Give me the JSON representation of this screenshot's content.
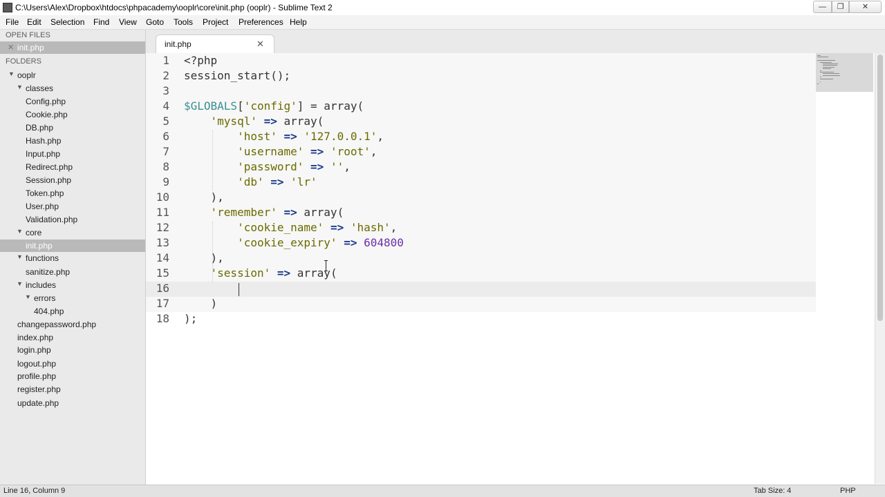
{
  "window": {
    "title": "C:\\Users\\Alex\\Dropbox\\htdocs\\phpacademy\\ooplr\\core\\init.php (ooplr) - Sublime Text 2",
    "min_glyph": "—",
    "max_glyph": "❐",
    "close_glyph": "✕"
  },
  "menu": [
    "File",
    "Edit",
    "Selection",
    "Find",
    "View",
    "Goto",
    "Tools",
    "Project",
    "Preferences",
    "Help"
  ],
  "sidebar": {
    "open_files_header": "OPEN FILES",
    "open_file": "init.php",
    "open_file_close": "✕",
    "folders_header": "FOLDERS",
    "tree": [
      {
        "label": "ooplr",
        "type": "folder"
      },
      {
        "label": "classes",
        "type": "folder"
      },
      {
        "label": "Config.php",
        "type": "file"
      },
      {
        "label": "Cookie.php",
        "type": "file"
      },
      {
        "label": "DB.php",
        "type": "file"
      },
      {
        "label": "Hash.php",
        "type": "file"
      },
      {
        "label": "Input.php",
        "type": "file"
      },
      {
        "label": "Redirect.php",
        "type": "file"
      },
      {
        "label": "Session.php",
        "type": "file"
      },
      {
        "label": "Token.php",
        "type": "file"
      },
      {
        "label": "User.php",
        "type": "file"
      },
      {
        "label": "Validation.php",
        "type": "file"
      },
      {
        "label": "core",
        "type": "folder"
      },
      {
        "label": "init.php",
        "type": "file",
        "active": true
      },
      {
        "label": "functions",
        "type": "folder"
      },
      {
        "label": "sanitize.php",
        "type": "file"
      },
      {
        "label": "includes",
        "type": "folder"
      },
      {
        "label": "errors",
        "type": "folder"
      },
      {
        "label": "404.php",
        "type": "file"
      },
      {
        "label": "changepassword.php",
        "type": "file"
      },
      {
        "label": "index.php",
        "type": "file"
      },
      {
        "label": "login.php",
        "type": "file"
      },
      {
        "label": "logout.php",
        "type": "file"
      },
      {
        "label": "profile.php",
        "type": "file"
      },
      {
        "label": "register.php",
        "type": "file"
      },
      {
        "label": "update.php",
        "type": "file"
      }
    ],
    "arrow_glyph": "▼"
  },
  "tab": {
    "label": "init.php",
    "close": "✕"
  },
  "editor": {
    "line_numbers": [
      "1",
      "2",
      "3",
      "4",
      "5",
      "6",
      "7",
      "8",
      "9",
      "10",
      "11",
      "12",
      "13",
      "14",
      "15",
      "16",
      "17",
      "18"
    ],
    "lines": [
      "<?php",
      "session_start();",
      "",
      "$GLOBALS['config'] = array(",
      "    'mysql' => array(",
      "        'host' => '127.0.0.1',",
      "        'username' => 'root',",
      "        'password' => '',",
      "        'db' => 'lr'",
      "    ),",
      "    'remember' => array(",
      "        'cookie_name' => 'hash',",
      "        'cookie_expiry' => 604800",
      "    ),",
      "    'session' => array(",
      "        ",
      "    )",
      ");"
    ]
  },
  "status": {
    "position": "Line 16, Column 9",
    "tab_size": "Tab Size: 4",
    "syntax": "PHP"
  },
  "colors": {
    "variable": "#3b8f8f",
    "string": "#6a6a00",
    "operator": "#1a3a8a",
    "number": "#6b2fa8",
    "sidebar_bg": "#eaeaea",
    "sidebar_active": "#b9b9b9"
  }
}
